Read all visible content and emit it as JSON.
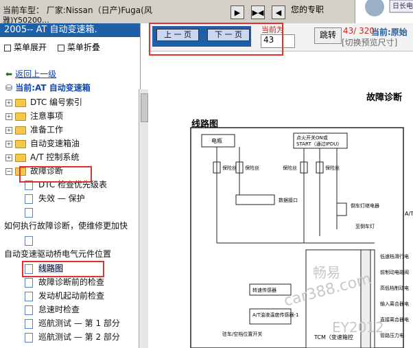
{
  "header": {
    "car_line1": "当前车型：  厂家:Nissan（日产)Fuga(风",
    "car_line2": "雅)Y50200…",
    "pro_text": "您的专职",
    "logo_text": "日长电"
  },
  "left": {
    "section_title": "2005-- AT 自动变速箱.",
    "expand": "菜单展开",
    "collapse": "菜单折叠",
    "back": "返回上一级",
    "current_node": "当前:AT 自动变速箱",
    "tree": [
      {
        "label": "DTC 编号索引",
        "type": "folder"
      },
      {
        "label": "注意事项",
        "type": "folder"
      },
      {
        "label": "准备工作",
        "type": "folder"
      },
      {
        "label": "自动变速箱油",
        "type": "folder"
      },
      {
        "label": "A/T 控制系统",
        "type": "folder"
      },
      {
        "label": "故障诊断",
        "type": "folder-open"
      },
      {
        "label": "DTC 检查优先级表",
        "type": "doc"
      },
      {
        "label": "失效 — 保护",
        "type": "doc"
      },
      {
        "label": "",
        "type": "doc"
      },
      {
        "label": "如何执行故障诊断，使维修更加快",
        "type": "text"
      },
      {
        "label": "",
        "type": "doc"
      },
      {
        "label": "自动变速驱动桥电气元件位置",
        "type": "text"
      },
      {
        "label": "线路图",
        "type": "doc-selected"
      },
      {
        "label": "故障诊断前的检查",
        "type": "doc"
      },
      {
        "label": "发动机起动前检查",
        "type": "doc"
      },
      {
        "label": "怠速时检查",
        "type": "doc"
      },
      {
        "label": "巡航测试 — 第 1 部分",
        "type": "doc"
      },
      {
        "label": "巡航测试 — 第 2 部分",
        "type": "doc"
      }
    ]
  },
  "right": {
    "prev": "上 一 页",
    "next": "下 一 页",
    "cur_label": "当前为",
    "page_value": "43",
    "jump": "跳转",
    "page_count": "43/ 320",
    "current_page": "当前:原始",
    "preview_toggle": "[切换预览尺寸]"
  },
  "diagram": {
    "title": "故障诊断",
    "subtitle": "线路图",
    "labels": [
      "电瓶",
      "点火开关ON或",
      "START（通过IPDU)",
      "保险丝",
      "保险丝",
      "保险丝",
      "保险丝",
      "数据接口",
      "倒车灯继电器",
      "至倒车灯",
      "低速档滑行电",
      "前制动电磁阀",
      "高低档制动电",
      "输入离合器电",
      "直接离合器电",
      "管路压力电",
      "转速传感器",
      "A/T油液温度传感器-1",
      "驻车/空档位置开关",
      "TCM（变速箱控",
      "A/T",
      "畅易",
      "car388.com",
      "EY2012"
    ]
  }
}
